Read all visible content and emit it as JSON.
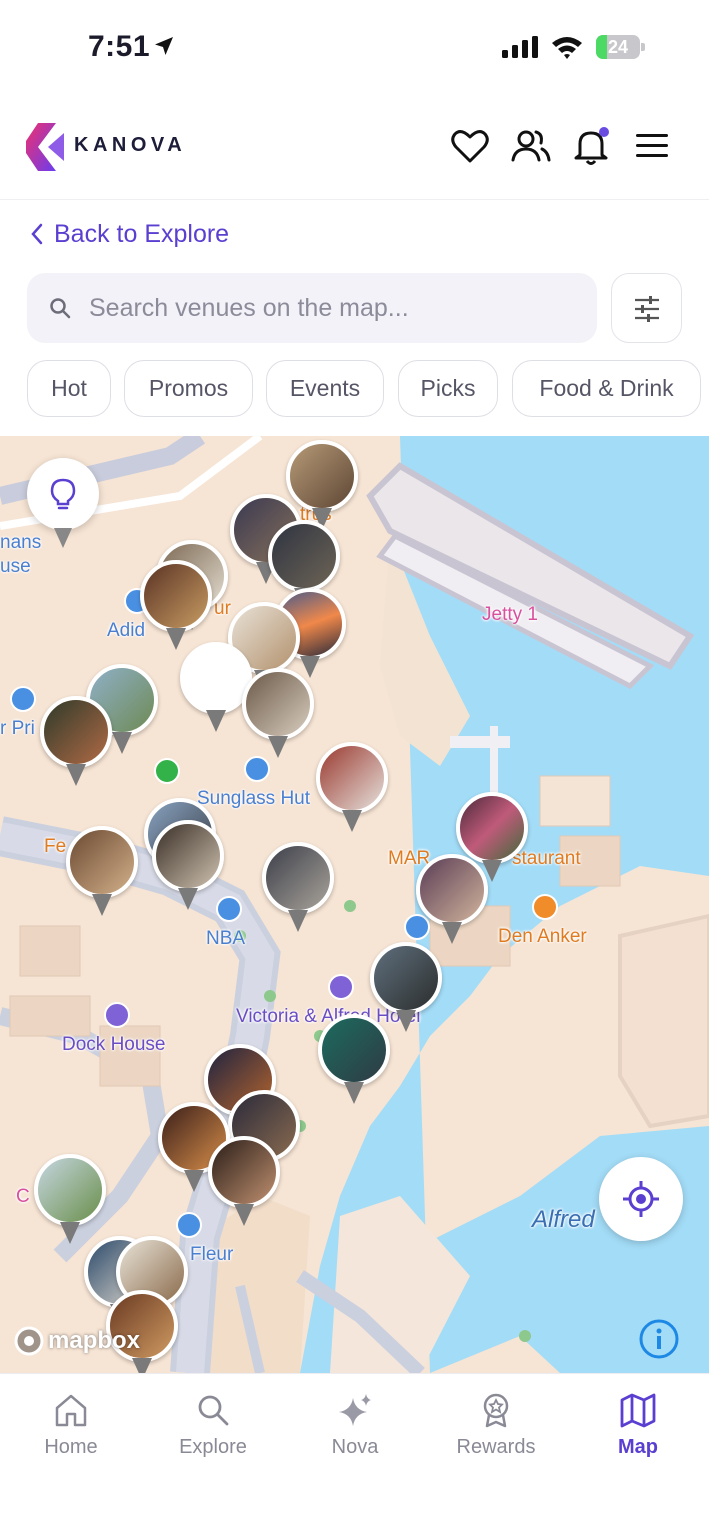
{
  "status_bar": {
    "time": "7:51",
    "battery": "24",
    "battery_level": 0.24
  },
  "header": {
    "brand": "KANOVA"
  },
  "back_link": {
    "label": "Back to Explore"
  },
  "search": {
    "placeholder": "Search venues on the map..."
  },
  "chips": [
    "Hot",
    "Promos",
    "Events",
    "Picks",
    "Food & Drink"
  ],
  "map": {
    "labels": {
      "jetty": "Jetty 1",
      "sunglass": "Sunglass Hut",
      "nba": "NBA",
      "dock_house": "Dock House",
      "victoria": "Victoria & Alfred Hotel",
      "den_anker": "Den Anker",
      "fleur": "Fleur",
      "alfred": "Alfred",
      "adidas": "Adid",
      "mans": "nans",
      "use": "use",
      "marr": "MAR",
      "estaurant": "staurant",
      "fe": "Fe",
      "pri": "r Pri",
      "c": "C",
      "trus": "trus",
      "ur": "ur"
    },
    "attribution": "mapbox"
  },
  "colors": {
    "accent": "#5b3fd1",
    "water": "#a3dcf7",
    "land": "#f7e7d8"
  },
  "tabs": [
    {
      "label": "Home",
      "icon": "home-icon"
    },
    {
      "label": "Explore",
      "icon": "search-icon"
    },
    {
      "label": "Nova",
      "icon": "sparkle-icon"
    },
    {
      "label": "Rewards",
      "icon": "rewards-icon"
    },
    {
      "label": "Map",
      "icon": "map-icon",
      "active": true
    }
  ]
}
